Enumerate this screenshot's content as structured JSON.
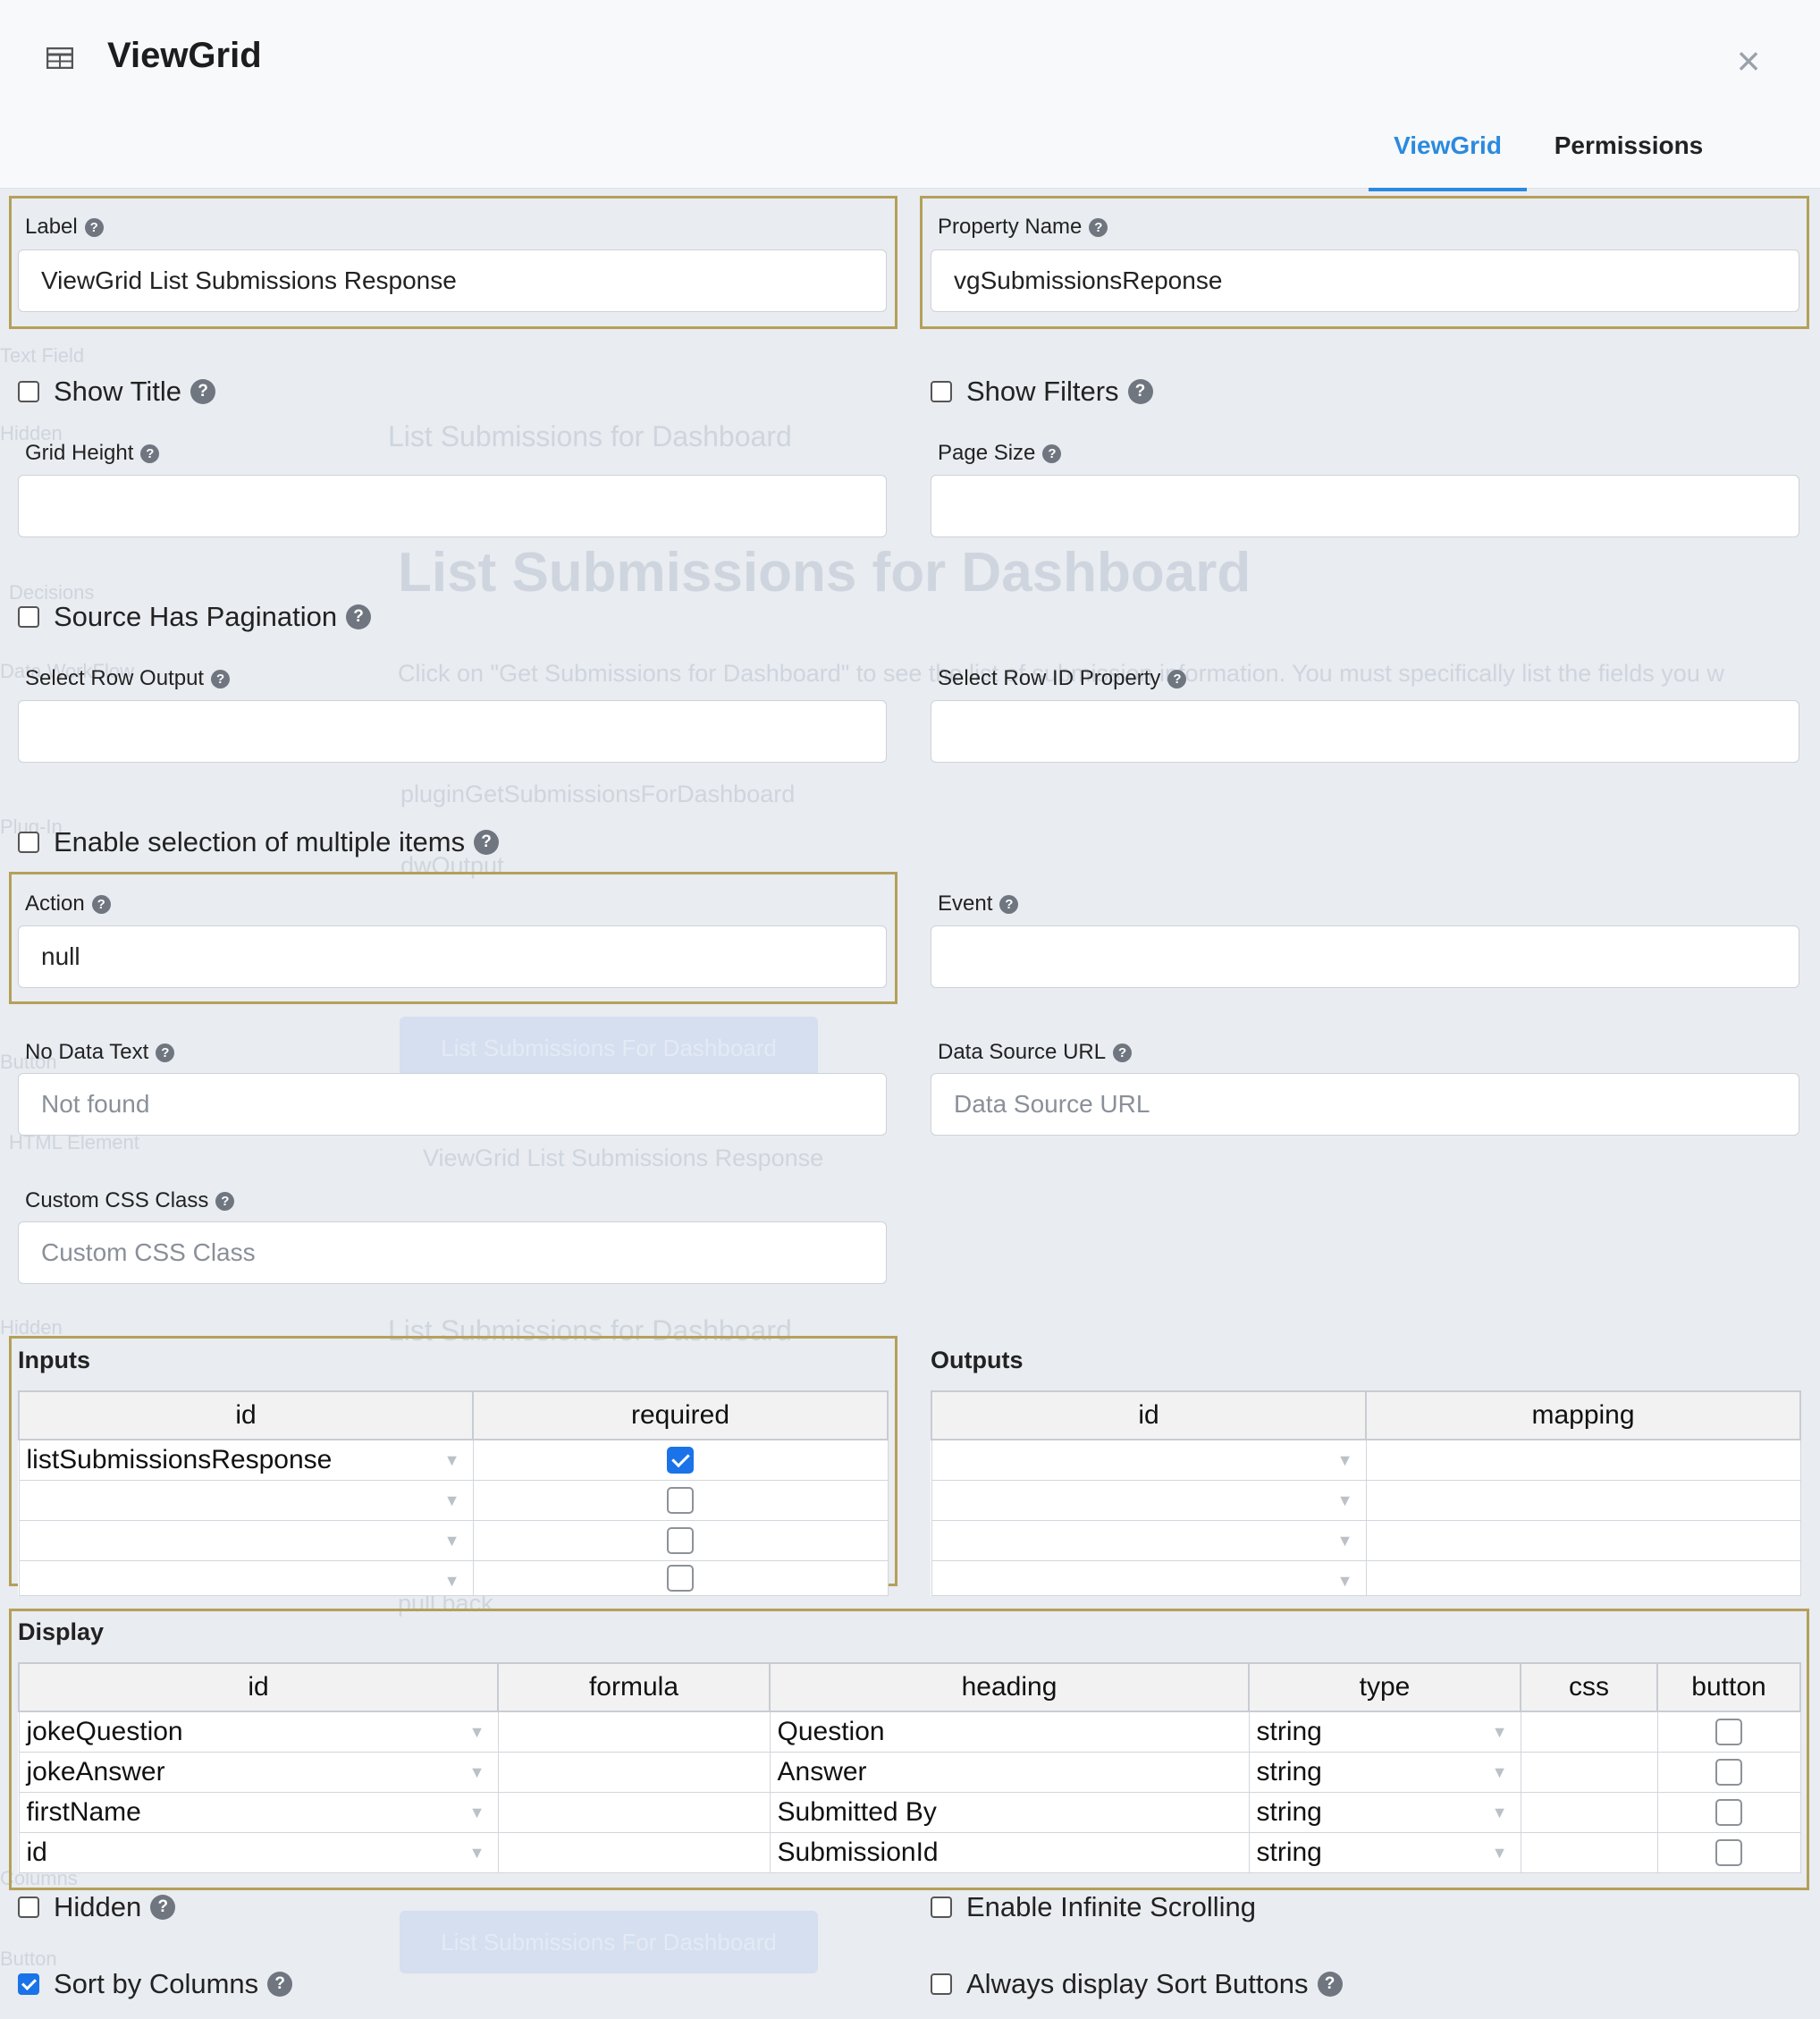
{
  "dialog": {
    "title": "ViewGrid",
    "tabs": [
      {
        "label": "ViewGrid",
        "active": true
      },
      {
        "label": "Permissions",
        "active": false
      }
    ]
  },
  "form": {
    "label": {
      "label": "Label",
      "value": "ViewGrid List Submissions Response"
    },
    "property_name": {
      "label": "Property Name",
      "value": "vgSubmissionsReponse"
    },
    "show_title": {
      "label": "Show Title",
      "checked": false
    },
    "show_filters": {
      "label": "Show Filters",
      "checked": false
    },
    "grid_height": {
      "label": "Grid Height",
      "value": ""
    },
    "page_size": {
      "label": "Page Size",
      "value": ""
    },
    "source_has_pagination": {
      "label": "Source Has Pagination",
      "checked": false
    },
    "select_row_output": {
      "label": "Select Row Output",
      "value": ""
    },
    "select_row_id_property": {
      "label": "Select Row ID Property",
      "value": ""
    },
    "enable_multi_select": {
      "label": "Enable selection of multiple items",
      "checked": false
    },
    "action": {
      "label": "Action",
      "value": "null"
    },
    "event": {
      "label": "Event",
      "value": ""
    },
    "no_data_text": {
      "label": "No Data Text",
      "placeholder": "Not found"
    },
    "data_source_url": {
      "label": "Data Source URL",
      "placeholder": "Data Source URL"
    },
    "custom_css_class": {
      "label": "Custom CSS Class",
      "placeholder": "Custom CSS Class"
    },
    "hidden": {
      "label": "Hidden",
      "checked": false
    },
    "enable_infinite_scrolling": {
      "label": "Enable Infinite Scrolling",
      "checked": false
    },
    "sort_by_columns": {
      "label": "Sort by Columns",
      "checked": true
    },
    "always_display_sort_buttons": {
      "label": "Always display Sort Buttons",
      "checked": false
    }
  },
  "inputs": {
    "title": "Inputs",
    "columns": [
      "id",
      "required"
    ],
    "rows": [
      {
        "id": "listSubmissionsResponse",
        "required": true
      },
      {
        "id": "",
        "required": false
      },
      {
        "id": "",
        "required": false
      },
      {
        "id": "",
        "required": false
      }
    ]
  },
  "outputs": {
    "title": "Outputs",
    "columns": [
      "id",
      "mapping"
    ],
    "rows": [
      {
        "id": "",
        "mapping": ""
      },
      {
        "id": "",
        "mapping": ""
      },
      {
        "id": "",
        "mapping": ""
      },
      {
        "id": "",
        "mapping": ""
      }
    ]
  },
  "display": {
    "title": "Display",
    "columns": [
      "id",
      "formula",
      "heading",
      "type",
      "css",
      "button"
    ],
    "rows": [
      {
        "id": "jokeQuestion",
        "formula": "",
        "heading": "Question",
        "type": "string",
        "css": "",
        "button": false
      },
      {
        "id": "jokeAnswer",
        "formula": "",
        "heading": "Answer",
        "type": "string",
        "css": "",
        "button": false
      },
      {
        "id": "firstName",
        "formula": "",
        "heading": "Submitted By",
        "type": "string",
        "css": "",
        "button": false
      },
      {
        "id": "id",
        "formula": "",
        "heading": "SubmissionId",
        "type": "string",
        "css": "",
        "button": false
      }
    ]
  },
  "background_page": {
    "side_items": [
      "Text Field",
      "Hidden",
      "Decisions",
      "Data WorkFlow",
      "Plug-In",
      "Button",
      "HTML Element",
      "Hidden",
      "Columns",
      "Button"
    ],
    "heading_small": "List Submissions for Dashboard",
    "heading_large": "List Submissions for Dashboard",
    "description": "Click on \"Get Submissions for Dashboard\" to see the list of submission information. You must specifically list the fields you w",
    "plugin_name": "pluginGetSubmissionsForDashboard",
    "output_name": "dwOutput",
    "button_label": "List Submissions For Dashboard",
    "grid_label": "ViewGrid List Submissions Response",
    "heading_small_2": "List Submissions for Dashboard",
    "pull_back": "pull back",
    "button_label_2": "List Submissions For Dashboard"
  },
  "colors": {
    "accent": "#2b8adf",
    "highlight": "#b4a05a",
    "checkbox": "#1a73e8"
  },
  "icons": {
    "title_icon": "grid-icon",
    "close": "close-icon",
    "help": "help-icon",
    "dropdown": "dropdown-arrow-icon"
  }
}
